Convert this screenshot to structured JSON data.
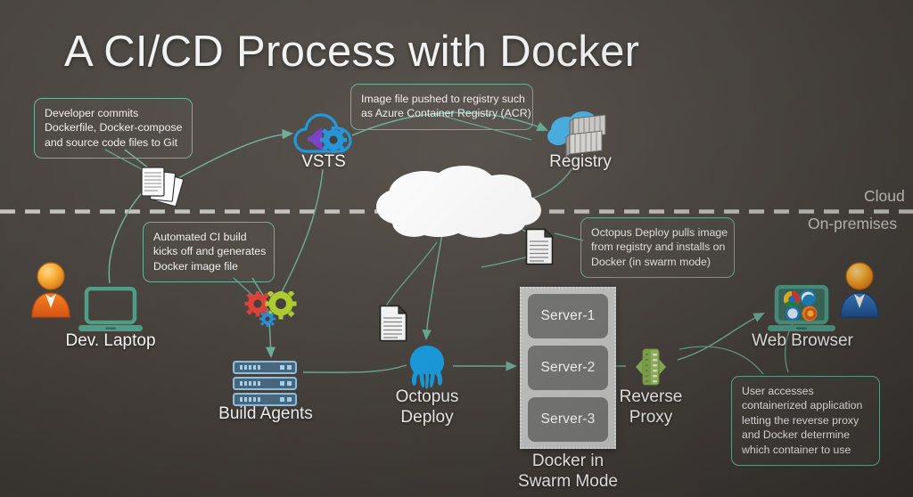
{
  "title": "A CI/CD Process with Docker",
  "zones": {
    "cloud": "Cloud",
    "onprem": "On-premises"
  },
  "callouts": {
    "commit": {
      "lines": [
        "Developer commits",
        "Dockerfile, Docker-compose",
        "and source code files to Git"
      ]
    },
    "push": {
      "lines": [
        "Image file pushed to registry such",
        "as Azure Container Registry (ACR)"
      ]
    },
    "ci": {
      "lines": [
        "Automated CI build",
        "kicks off and generates",
        "Docker image file"
      ]
    },
    "octopus": {
      "lines": [
        "Octopus Deploy pulls image",
        "from registry and installs on",
        "Docker (in swarm mode)"
      ]
    },
    "user": {
      "lines": [
        "User accesses",
        "containerized application",
        "letting the reverse proxy",
        "and Docker determine",
        "which container to use"
      ]
    }
  },
  "nodes": {
    "dev_laptop": "Dev. Laptop",
    "vsts": "VSTS",
    "registry": "Registry",
    "build_agents": "Build Agents",
    "octopus_deploy_l1": "Octopus",
    "octopus_deploy_l2": "Deploy",
    "reverse_proxy_l1": "Reverse",
    "reverse_proxy_l2": "Proxy",
    "web_browser": "Web Browser",
    "swarm_l1": "Docker in",
    "swarm_l2": "Swarm Mode"
  },
  "swarm": {
    "servers": [
      "Server-1",
      "Server-2",
      "Server-3"
    ]
  },
  "icons": {
    "developer_person": "person-orange-icon",
    "laptop": "laptop-icon",
    "documents_stack": "documents-stack-icon",
    "vsts_cloud": "cloud-gear-icon",
    "registry_cloud": "cloud-containers-icon",
    "big_cloud": "cloud-shape-icon",
    "gears": "gears-icon",
    "servers_rack": "server-rack-icon",
    "document_1": "document-icon",
    "document_2": "document-icon",
    "octopus": "octopus-icon",
    "reverse_proxy": "proxy-arrows-icon",
    "browser_laptop": "browser-laptop-icon",
    "user_person": "person-blue-icon"
  },
  "colors": {
    "accent_line": "#6fae99",
    "callout_border": "#6fae99",
    "teal": "#4d9d86",
    "azure_blue": "#2ea7e0",
    "octopus_blue": "#1ba0e2",
    "proxy_green": "#8fb85a",
    "gear_red": "#e0433a",
    "gear_green": "#b0cf30",
    "gear_blue": "#2d8fd4",
    "server_blue": "#8fc4e8",
    "background": "#46413d",
    "swarm_bg": "#c9c9c7",
    "server_box": "#7b7b79"
  }
}
